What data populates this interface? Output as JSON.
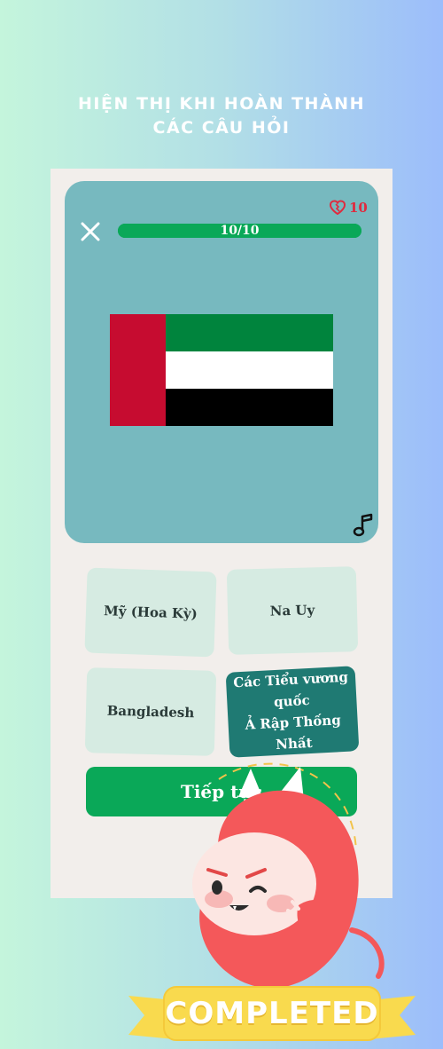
{
  "headline": {
    "line1": "HIỆN THỊ KHI HOÀN THÀNH",
    "line2": "CÁC CÂU HỎI"
  },
  "quiz": {
    "progress_text": "10/10",
    "progress_value": 1.0,
    "lives": "10",
    "flag": {
      "name": "uae-flag",
      "colors": {
        "red": "#c60c30",
        "green": "#00843d",
        "white": "#ffffff",
        "black": "#000000"
      }
    },
    "answers": [
      {
        "label_1": "Mỹ (Hoa Kỳ)",
        "label_2": ""
      },
      {
        "label_1": "Na Uy",
        "label_2": ""
      },
      {
        "label_1": "Bangladesh",
        "label_2": ""
      },
      {
        "label_1": "Các Tiểu vương quốc",
        "label_2": "Ả Rập Thống Nhất"
      }
    ],
    "selected_index": 3,
    "check_label": "Tiếp tục"
  },
  "banner": {
    "label": "COMPLETED"
  },
  "colors": {
    "card": "#77b9bf",
    "accent_green": "#0aa858",
    "answer_bg": "#d6ebe2",
    "answer_selected": "#1f7a73",
    "mascot_red": "#f4585a",
    "banner_yellow": "#f9da4e"
  },
  "icons": [
    "close-icon",
    "heart-icon",
    "music-note-icon"
  ]
}
